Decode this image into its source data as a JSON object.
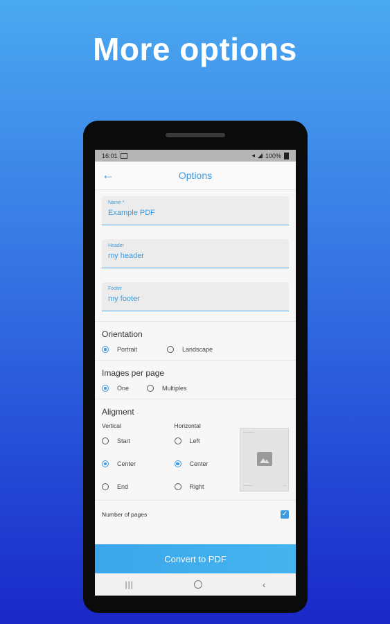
{
  "headline": "More options",
  "status_bar": {
    "time": "16:01",
    "battery": "100%"
  },
  "app_bar": {
    "title": "Options"
  },
  "fields": [
    {
      "label": "Name *",
      "value": "Example PDF"
    },
    {
      "label": "Header",
      "value": "my header"
    },
    {
      "label": "Footer",
      "value": "my footer"
    }
  ],
  "orientation": {
    "title": "Orientation",
    "options": [
      {
        "label": "Portrait",
        "selected": true
      },
      {
        "label": "Landscape",
        "selected": false
      }
    ]
  },
  "images_per_page": {
    "title": "Images per page",
    "options": [
      {
        "label": "One",
        "selected": true
      },
      {
        "label": "Multiples",
        "selected": false
      }
    ]
  },
  "alignment": {
    "title": "Aligment",
    "vertical": {
      "title": "Vertical",
      "options": [
        "Start",
        "Center",
        "End"
      ],
      "selected": "Center"
    },
    "horizontal": {
      "title": "Horizontal",
      "options": [
        "Left",
        "Center",
        "Right"
      ],
      "selected": "Center"
    }
  },
  "number_of_pages": {
    "label": "Number of pages",
    "checked": true
  },
  "convert_button": "Convert to PDF",
  "colors": {
    "accent": "#3a9be0",
    "background_top": "#4aa9f0",
    "background_bottom": "#1a28c8"
  }
}
